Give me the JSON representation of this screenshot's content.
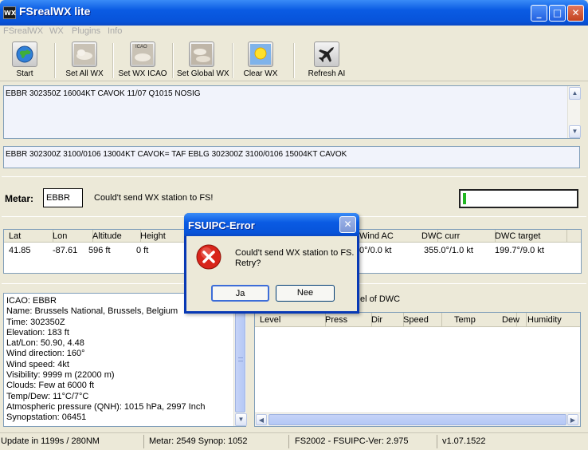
{
  "window": {
    "title": "FSrealWX lite",
    "logo_text": "WX",
    "minimize": "_",
    "maximize": "□",
    "close": "✕"
  },
  "menu": [
    "FSrealWX",
    "WX",
    "Plugins",
    "Info"
  ],
  "toolbar": [
    {
      "label": "Start",
      "icon": "globe-icon"
    },
    {
      "label": "Set All WX",
      "icon": "cloud-icon"
    },
    {
      "label": "Set WX ICAO",
      "icon": "icao-cloud-icon",
      "badge": "ICAO"
    },
    {
      "label": "Set Global WX",
      "icon": "global-cloud-icon"
    },
    {
      "label": "Clear WX",
      "icon": "sun-icon"
    },
    {
      "label": "Refresh AI",
      "icon": "airplane-icon"
    }
  ],
  "metar_text": "EBBR 302350Z 16004KT CAVOK 11/07 Q1015 NOSIG",
  "taf_text": "EBBR 302300Z 3100/0106 13004KT CAVOK= TAF EBLG 302300Z 3100/0106 15004KT CAVOK",
  "metar_row": {
    "label": "Metar:",
    "value": "EBBR",
    "status": "Could't send WX station to FS!",
    "progress": 0.02
  },
  "position_table": {
    "headers": [
      "Lat",
      "Lon",
      "Altitude",
      "Height",
      "Wind AC",
      "DWC curr",
      "DWC target"
    ],
    "row": [
      "41.85",
      "-87.61",
      "596 ft",
      "0 ft",
      "0°/0.0 kt",
      "355.0°/1.0 kt",
      "199.7°/9.0 kt"
    ]
  },
  "station_info": [
    "ICAO: EBBR",
    "Name: Brussels National, Brussels, Belgium",
    "Time: 302350Z",
    "Elevation: 183 ft",
    "Lat/Lon: 50.90, 4.48",
    "Wind direction: 160°",
    "Wind speed: 4kt",
    "Visibility: 9999 m (22000 m)",
    "Clouds: Few at 6000 ft",
    "Temp/Dew: 11°C/7°C",
    "Atmospheric pressure (QNH): 1015 hPa, 2997 Inch",
    "Synopstation: 06451"
  ],
  "levels": {
    "caption": "el of DWC",
    "headers": [
      "Level",
      "Press",
      "Dir",
      "Speed",
      "Temp",
      "Dew",
      "Humidity"
    ]
  },
  "statusbar": [
    "Update in 1199s / 280NM",
    "Metar: 2549 Synop: 1052",
    "FS2002 - FSUIPC-Ver: 2.975",
    "v1.07.1522"
  ],
  "dialog": {
    "title": "FSUIPC-Error",
    "close": "✕",
    "message_line1": "Could't send WX station to FS.",
    "message_line2": "Retry?",
    "yes_label": "Ja",
    "no_label": "Nee"
  },
  "colors": {
    "titlebar": "#0a5be3",
    "progress": "#22b722",
    "error_icon": "#d8251b"
  }
}
